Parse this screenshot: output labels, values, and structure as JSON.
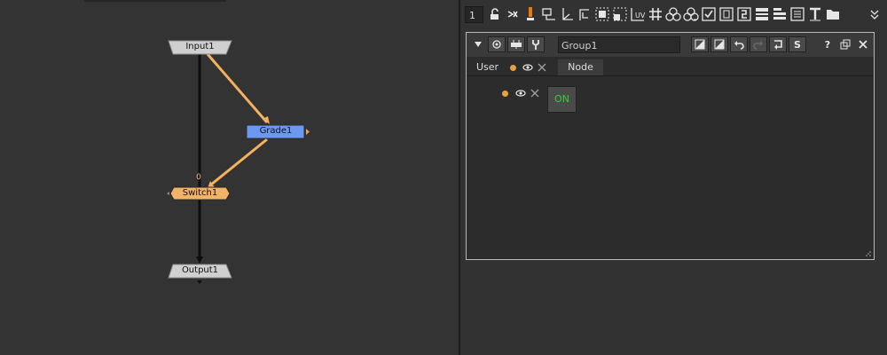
{
  "nodes": {
    "input": "Input1",
    "grade": "Grade1",
    "switch": "Switch1",
    "output": "Output1",
    "switch_input_index": "0"
  },
  "toolbar": {
    "frame_value": "1",
    "icons": [
      "lock-icon",
      "speed-icon",
      "exclamation-icon",
      "2d-transform-icon",
      "axis-icon",
      "crop-icon",
      "bbox-icon",
      "format-icon",
      "uv-icon",
      "grid-icon",
      "color-circles-icon",
      "channels-icon",
      "checkbox-icon",
      "field-icon",
      "script-icon",
      "panel-icon",
      "list-icon",
      "text-icon",
      "folder-icon",
      "more-icon"
    ],
    "uv_label": "UV"
  },
  "properties": {
    "node_name": "Group1",
    "tabs": {
      "user": "User",
      "node": "Node"
    },
    "on_button": "ON",
    "s_label": "S",
    "help_label": "?"
  },
  "colors": {
    "grade_node": "#6b99f2",
    "switch_node": "#f2b268",
    "pipe": "#f5b060",
    "on_text": "#32d232"
  }
}
